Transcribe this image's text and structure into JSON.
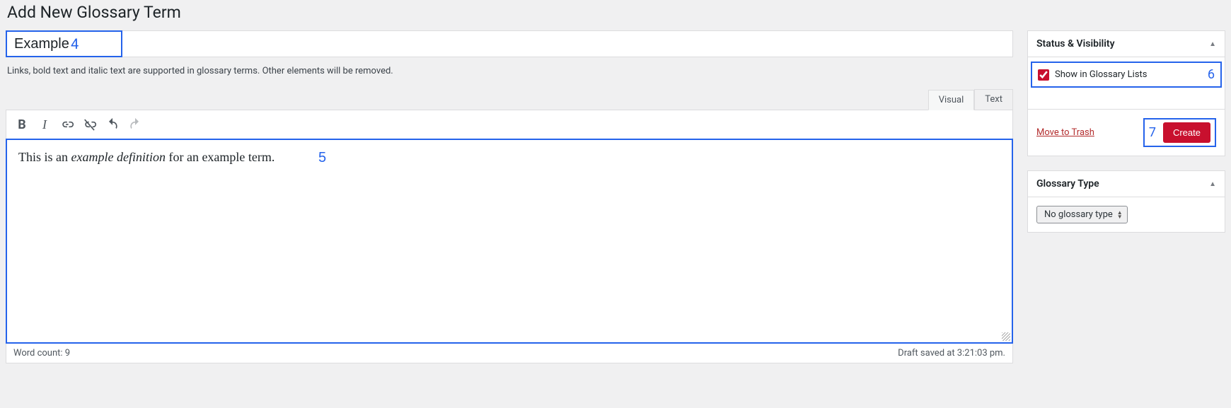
{
  "page": {
    "heading": "Add New Glossary Term",
    "hint": "Links, bold text and italic text are supported in glossary terms. Other elements will be removed."
  },
  "title_field": {
    "value": "Example",
    "annot": "4"
  },
  "editor": {
    "tabs": {
      "visual": "Visual",
      "text": "Text",
      "active": "visual"
    },
    "content_prefix": "This is an ",
    "content_italic": "example definition",
    "content_suffix": " for an example term.",
    "annot": "5",
    "footer": {
      "word_count_label": "Word count: 9",
      "draft_saved": "Draft saved at 3:21:03 pm."
    }
  },
  "sidebar": {
    "status_box": {
      "title": "Status & Visibility",
      "show_in_lists_label": "Show in Glossary Lists",
      "show_in_lists_checked": true,
      "annot_checkbox": "6",
      "trash_label": "Move to Trash",
      "create_label": "Create",
      "annot_action": "7"
    },
    "type_box": {
      "title": "Glossary Type",
      "selected": "No glossary type"
    }
  }
}
